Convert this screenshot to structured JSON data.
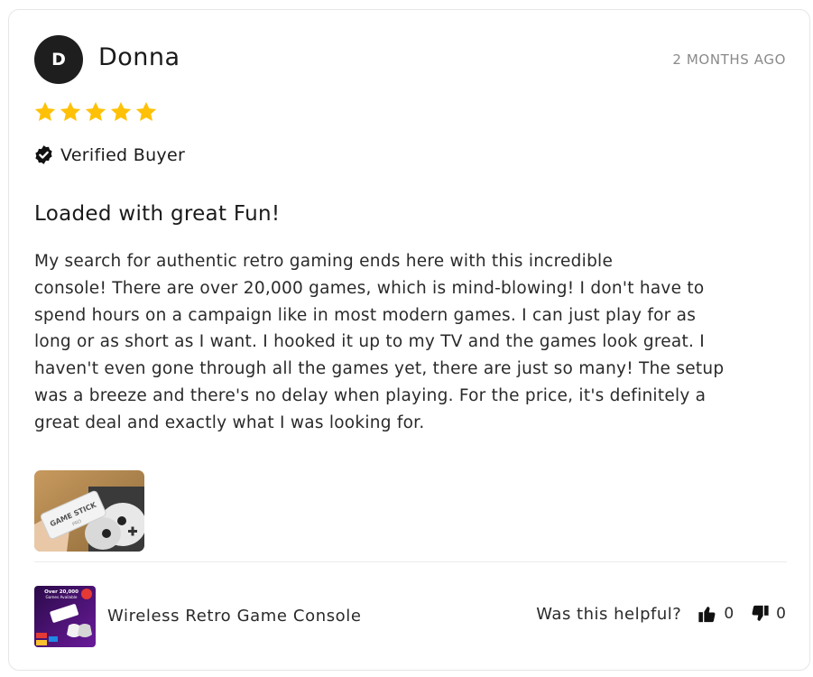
{
  "review": {
    "avatar_initial": "D",
    "reviewer_name": "Donna",
    "date": "2 MONTHS AGO",
    "rating": 5,
    "rating_max": 5,
    "star_color": "#FFC107",
    "verified_label": "Verified Buyer",
    "title": "Loaded with great Fun!",
    "body": "My search for authentic retro gaming ends here with this incredible\nconsole! There are over 20,000 games, which is mind-blowing! I don't have to\nspend hours on a campaign like in most modern games. I can just play for as\nlong or as short as I want. I hooked it up to my TV and the games look great. I\nhaven't even gone through all the games yet, there are just so many! The setup\nwas a breeze and there's no delay when playing. For the price, it's definitely a\ngreat deal and exactly what I was looking for.",
    "photo": {
      "stick_label": "GAME STICK",
      "stick_sublabel": "PRO"
    }
  },
  "product": {
    "name": "Wireless Retro Game Console",
    "thumb_heading": "Over 20,000",
    "thumb_subheading": "Games Available"
  },
  "helpful": {
    "label": "Was this helpful?",
    "up_count": "0",
    "down_count": "0"
  },
  "icons": {
    "verified": "verified-badge-icon",
    "thumbs_up": "thumbs-up-icon",
    "thumbs_down": "thumbs-down-icon",
    "star": "star-icon"
  }
}
